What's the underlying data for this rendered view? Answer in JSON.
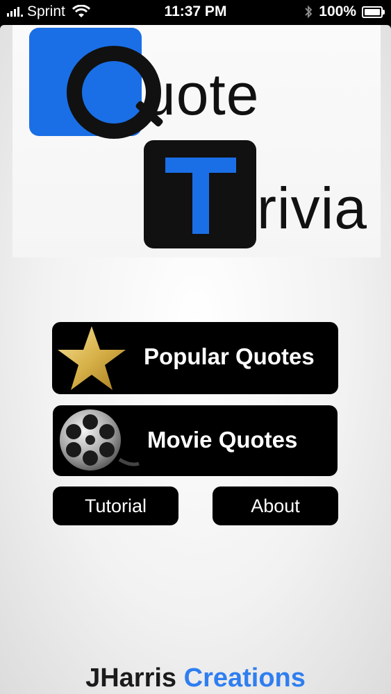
{
  "status_bar": {
    "carrier": "Sprint",
    "time": "11:37 PM",
    "battery": "100%"
  },
  "logo": {
    "word_one_rest": "uote",
    "word_two_rest": "rivia",
    "colors": {
      "blue": "#1a6fe6",
      "dark": "#111111"
    }
  },
  "menu": {
    "popular_label": "Popular Quotes",
    "movie_label": "Movie Quotes",
    "tutorial_label": "Tutorial",
    "about_label": "About"
  },
  "footer": {
    "part_one": "JHarris",
    "part_two": "Creations",
    "colors": {
      "part_one": "#1b1b1b",
      "part_two": "#2f7ef0"
    }
  },
  "icons": [
    "signal-icon",
    "wifi-icon",
    "bluetooth-icon",
    "battery-icon",
    "star-icon",
    "film-reel-icon"
  ]
}
